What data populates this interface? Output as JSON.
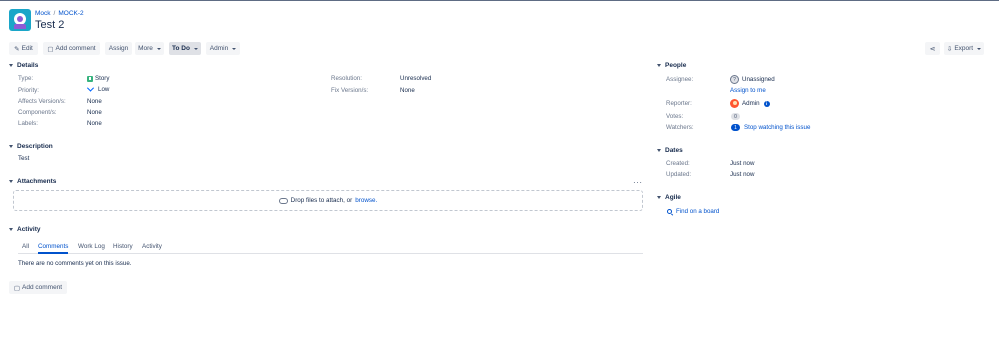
{
  "breadcrumb": {
    "project": "Mock",
    "separator": "/",
    "issue_key": "MOCK-2"
  },
  "issue": {
    "title": "Test 2"
  },
  "toolbar": {
    "edit": "Edit",
    "add_comment": "Add comment",
    "assign": "Assign",
    "more": "More",
    "status": "To Do",
    "admin": "Admin",
    "export": "Export"
  },
  "details": {
    "heading": "Details",
    "type_label": "Type:",
    "type_value": "Story",
    "priority_label": "Priority:",
    "priority_value": "Low",
    "affects_label": "Affects Version/s:",
    "affects_value": "None",
    "component_label": "Component/s:",
    "component_value": "None",
    "labels_label": "Labels:",
    "labels_value": "None",
    "resolution_label": "Resolution:",
    "resolution_value": "Unresolved",
    "fix_label": "Fix Version/s:",
    "fix_value": "None"
  },
  "description": {
    "heading": "Description",
    "text": "Test"
  },
  "attachments": {
    "heading": "Attachments",
    "drop_text": "Drop files to attach, or",
    "browse": "browse.",
    "more_icon": "ellipsis-icon"
  },
  "activity": {
    "heading": "Activity",
    "tabs": [
      "All",
      "Comments",
      "Work Log",
      "History",
      "Activity"
    ],
    "active_tab": "Comments",
    "empty": "There are no comments yet on this issue.",
    "add_comment": "Add comment"
  },
  "people": {
    "heading": "People",
    "assignee_label": "Assignee:",
    "assignee_value": "Unassigned",
    "assign_to_me": "Assign to me",
    "reporter_label": "Reporter:",
    "reporter_value": "Admin",
    "votes_label": "Votes:",
    "votes_value": "0",
    "watchers_label": "Watchers:",
    "watchers_count": "1",
    "watch_link": "Stop watching this issue"
  },
  "dates": {
    "heading": "Dates",
    "created_label": "Created:",
    "created_value": "Just now",
    "updated_label": "Updated:",
    "updated_value": "Just now"
  },
  "agile": {
    "heading": "Agile",
    "find_board": "Find on a board"
  },
  "colors": {
    "link": "#0052cc",
    "story": "#36b37e",
    "avatar_admin": "#ff5630",
    "project_avatar": "#1ba6c8"
  }
}
